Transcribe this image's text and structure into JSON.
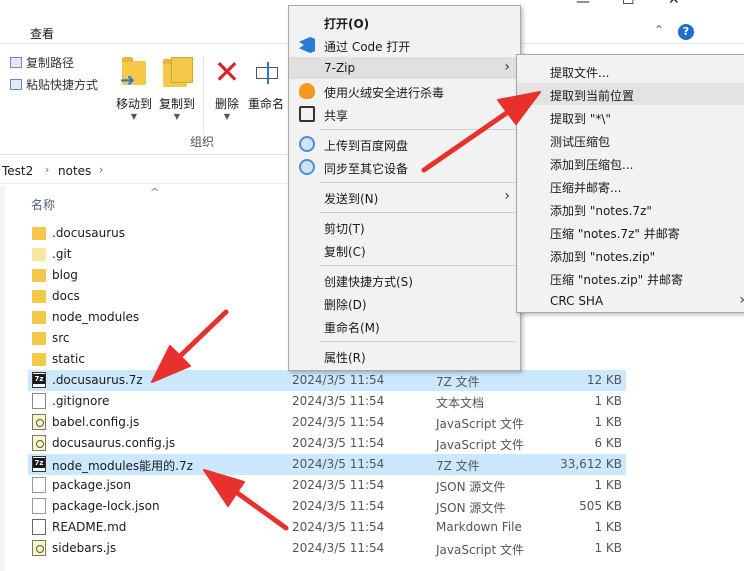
{
  "ribbon": {
    "tab_view": "查看",
    "copy_path": "复制路径",
    "paste_shortcut": "粘贴快捷方式",
    "move_to": "移动到",
    "copy_to": "复制到",
    "delete": "删除",
    "rename": "重命名",
    "group_organize": "组织"
  },
  "breadcrumb": [
    "Test2",
    "notes"
  ],
  "columns": {
    "name": "名称"
  },
  "files": [
    {
      "name": ".docusaurus",
      "date": "",
      "type": "",
      "size": "",
      "icon": "folder-icon"
    },
    {
      "name": ".git",
      "date": "",
      "type": "",
      "size": "",
      "icon": "folder-light-icon"
    },
    {
      "name": "blog",
      "date": "",
      "type": "",
      "size": "",
      "icon": "folder-icon"
    },
    {
      "name": "docs",
      "date": "",
      "type": "",
      "size": "",
      "icon": "folder-icon"
    },
    {
      "name": "node_modules",
      "date": "",
      "type": "",
      "size": "",
      "icon": "folder-icon"
    },
    {
      "name": "src",
      "date": "",
      "type": "",
      "size": "",
      "icon": "folder-icon"
    },
    {
      "name": "static",
      "date": "",
      "type": "",
      "size": "",
      "icon": "folder-icon"
    },
    {
      "name": ".docusaurus.7z",
      "date": "2024/3/5 11:54",
      "type": "7Z 文件",
      "size": "12 KB",
      "icon": "7z-archive-icon",
      "selected": true
    },
    {
      "name": ".gitignore",
      "date": "2024/3/5 11:54",
      "type": "文本文档",
      "size": "1 KB",
      "icon": "text-file-icon"
    },
    {
      "name": "babel.config.js",
      "date": "2024/3/5 11:54",
      "type": "JavaScript 文件",
      "size": "1 KB",
      "icon": "js-file-icon"
    },
    {
      "name": "docusaurus.config.js",
      "date": "2024/3/5 11:54",
      "type": "JavaScript 文件",
      "size": "6 KB",
      "icon": "js-file-icon"
    },
    {
      "name": "node_modules能用的.7z",
      "date": "2024/3/5 11:54",
      "type": "7Z 文件",
      "size": "33,612 KB",
      "icon": "7z-archive-icon",
      "selected": true
    },
    {
      "name": "package.json",
      "date": "2024/3/5 11:54",
      "type": "JSON 源文件",
      "size": "1 KB",
      "icon": "json-file-icon"
    },
    {
      "name": "package-lock.json",
      "date": "2024/3/5 11:54",
      "type": "JSON 源文件",
      "size": "505 KB",
      "icon": "json-file-icon"
    },
    {
      "name": "README.md",
      "date": "2024/3/5 11:54",
      "type": "Markdown File",
      "size": "1 KB",
      "icon": "markdown-file-icon"
    },
    {
      "name": "sidebars.js",
      "date": "2024/3/5 11:54",
      "type": "JavaScript 文件",
      "size": "1 KB",
      "icon": "js-file-icon"
    }
  ],
  "context_menu": {
    "open": "打开(O)",
    "open_with_code": "通过 Code 打开",
    "sevenzip": "7-Zip",
    "antivirus": "使用火绒安全进行杀毒",
    "share": "共享",
    "upload_baidu": "上传到百度网盘",
    "sync_devices": "同步至其它设备",
    "send_to": "发送到(N)",
    "cut": "剪切(T)",
    "copy": "复制(C)",
    "create_shortcut": "创建快捷方式(S)",
    "delete": "删除(D)",
    "rename": "重命名(M)",
    "properties": "属性(R)"
  },
  "sevenzip_submenu": [
    "提取文件...",
    "提取到当前位置",
    "提取到 \"*\\\"",
    "测试压缩包",
    "添加到压缩包...",
    "压缩并邮寄...",
    "添加到 \"notes.7z\"",
    "压缩 \"notes.7z\" 并邮寄",
    "添加到 \"notes.zip\"",
    "压缩 \"notes.zip\" 并邮寄",
    "CRC SHA"
  ],
  "colors": {
    "selection": "#cce8ff",
    "annotation_arrow": "#e8302c",
    "help": "#1f6fd0"
  }
}
